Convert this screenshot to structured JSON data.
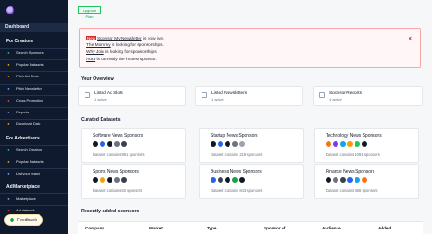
{
  "sidebar": {
    "dashboard": "Dashboard",
    "creators_header": "For Creators",
    "creators_items": [
      {
        "label": "Search Sponsors",
        "icon": "search-icon",
        "color": "#22c55e"
      },
      {
        "label": "Popular Datasets",
        "icon": "star-icon",
        "color": "#f59e0b"
      },
      {
        "label": "Pitch Ad Slots",
        "icon": "megaphone-icon",
        "color": "#f59e0b"
      },
      {
        "label": "Pitch Newsletter",
        "icon": "envelope-icon",
        "color": "#60a5fa"
      },
      {
        "label": "Cross Promotion",
        "icon": "swap-icon",
        "color": "#ef4444"
      },
      {
        "label": "Reports",
        "icon": "chart-icon",
        "color": "#a78bfa"
      },
      {
        "label": "Download Data",
        "icon": "download-icon",
        "color": "#f59e0b"
      }
    ],
    "advertisers_header": "For Advertisers",
    "advertisers_items": [
      {
        "label": "Search Creators",
        "icon": "search-icon",
        "color": "#22c55e"
      },
      {
        "label": "Popular Datasets",
        "icon": "star-icon",
        "color": "#f59e0b"
      },
      {
        "label": "List your brand",
        "icon": "tag-icon",
        "color": "#60a5fa"
      }
    ],
    "marketplace_header": "Ad Marketplace",
    "marketplace_items": [
      {
        "label": "Marketplace",
        "icon": "store-icon",
        "color": "#a78bfa"
      },
      {
        "label": "Ad Network",
        "icon": "network-icon",
        "color": "#ef4444"
      }
    ],
    "feedback_label": "Feedback"
  },
  "plan_badge": "Upgrade Plan",
  "notice": {
    "new_tag": "New",
    "line1_link": "Sponsor My Newsletter",
    "line1_rest": " is now live.",
    "line2_link": "The Mommy",
    "line2_rest": " is looking for sponsorships.",
    "line3_link": "Why Join",
    "line3_rest": " is looking for sponsorships.",
    "line4_link": "Aura",
    "line4_rest": " is currently the hottest sponsor.",
    "close": "×"
  },
  "overview": {
    "title": "Your Overview",
    "cards": [
      {
        "title": "Listed Ad Slots",
        "sub": "1 active"
      },
      {
        "title": "Listed Newsletters",
        "sub": "1 active"
      },
      {
        "title": "Sponsor Reports",
        "sub": "4 active"
      }
    ]
  },
  "curated": {
    "title": "Curated Datasets",
    "cards": [
      {
        "title": "Software News Sponsors",
        "count": "Dataset contains 991 sponsors",
        "colors": [
          "#111827",
          "#2563eb",
          "#111827",
          "#6b7280",
          "#374151"
        ]
      },
      {
        "title": "Startup News Sponsors",
        "count": "Dataset contains 218 sponsors",
        "colors": [
          "#111827",
          "#2563eb",
          "#111827",
          "#6b7280",
          "#9ca3af"
        ]
      },
      {
        "title": "Technology News Sponsors",
        "count": "Dataset contains 1081 sponsors",
        "colors": [
          "#f97316",
          "#7c3aed",
          "#0ea5e9",
          "#f59e0b",
          "#22c55e",
          "#111827"
        ]
      },
      {
        "title": "Sports News Sponsors",
        "count": "Dataset contains 83 sponsors",
        "colors": [
          "#111827",
          "#f59e0b",
          "#111827",
          "#6b7280",
          "#374151"
        ]
      },
      {
        "title": "Business News Sponsors",
        "count": "Dataset contains 843 sponsors",
        "colors": [
          "#2563eb",
          "#374151",
          "#111827",
          "#16a34a",
          "#111827"
        ]
      },
      {
        "title": "Finance News Sponsors",
        "count": "Dataset contains 368 sponsors",
        "colors": [
          "#111827",
          "#6b7280",
          "#374151",
          "#2563eb",
          "#0ea5e9",
          "#f97316"
        ]
      }
    ]
  },
  "recent": {
    "title": "Recently added sponsors",
    "columns": [
      "Company",
      "Market",
      "Type",
      "Sponsor of",
      "Audience",
      "Added"
    ]
  }
}
